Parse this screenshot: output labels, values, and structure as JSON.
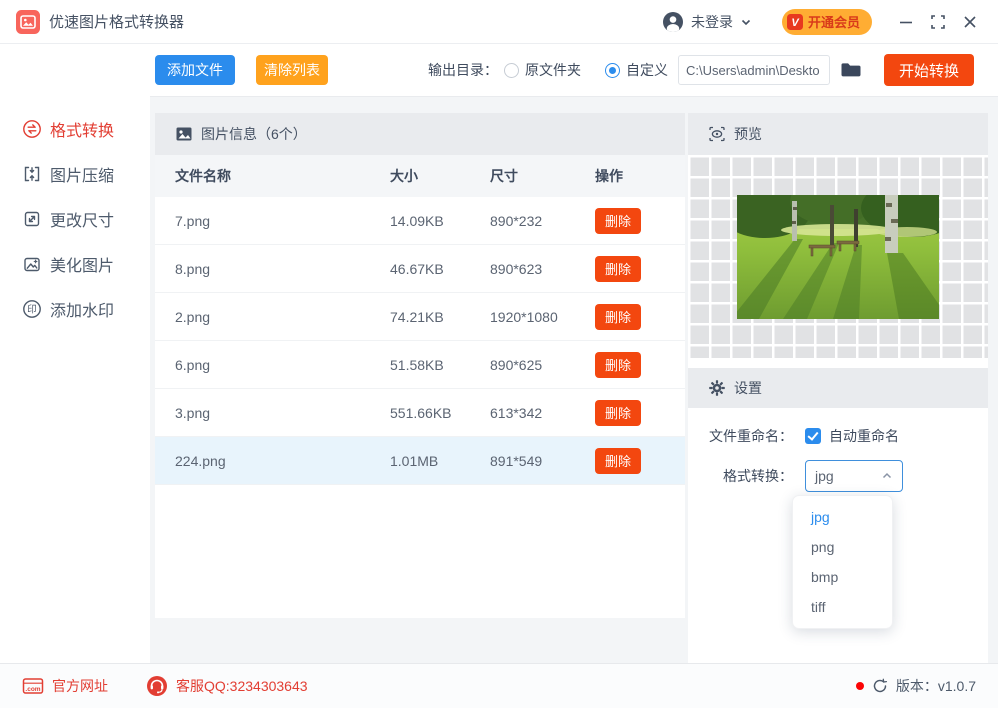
{
  "colors": {
    "brand": "#f8655c",
    "blue": "#2b8ced",
    "orange": "#ffa21d",
    "vermillion": "#f3470f",
    "vip": "#ffad33",
    "red": "#e23e33"
  },
  "window": {
    "title": "优速图片格式转换器",
    "login": "未登录",
    "vip": "开通会员"
  },
  "toolbar": {
    "add": "添加文件",
    "clear": "清除列表",
    "output_label": "输出目录：",
    "radio_source": "原文件夹",
    "radio_custom": "自定义",
    "path": "C:\\Users\\admin\\Deskto",
    "start": "开始转换"
  },
  "sidebar": {
    "items": [
      {
        "id": "format-convert",
        "label": "格式转换",
        "active": true
      },
      {
        "id": "compress",
        "label": "图片压缩",
        "active": false
      },
      {
        "id": "resize",
        "label": "更改尺寸",
        "active": false
      },
      {
        "id": "beautify",
        "label": "美化图片",
        "active": false
      },
      {
        "id": "watermark",
        "label": "添加水印",
        "active": false
      }
    ]
  },
  "table": {
    "panel_title": "图片信息（6个）",
    "headers": [
      "文件名称",
      "大小",
      "尺寸",
      "操作"
    ],
    "delete_label": "删除",
    "selected_index": 5,
    "rows": [
      {
        "name": "7.png",
        "size": "14.09KB",
        "dim": "890*232"
      },
      {
        "name": "8.png",
        "size": "46.67KB",
        "dim": "890*623"
      },
      {
        "name": "2.png",
        "size": "74.21KB",
        "dim": "1920*1080"
      },
      {
        "name": "6.png",
        "size": "51.58KB",
        "dim": "890*625"
      },
      {
        "name": "3.png",
        "size": "551.66KB",
        "dim": "613*342"
      },
      {
        "name": "224.png",
        "size": "1.01MB",
        "dim": "891*549"
      }
    ]
  },
  "preview": {
    "title": "预览"
  },
  "settings": {
    "title": "设置",
    "rename_label": "文件重命名：",
    "rename_checkbox": "自动重命名",
    "rename_checked": true,
    "format_label": "格式转换：",
    "format_value": "jpg",
    "options": [
      "jpg",
      "png",
      "bmp",
      "tiff"
    ]
  },
  "footer": {
    "site": "官方网址",
    "qq": "客服QQ:3234303643",
    "version": "版本：v1.0.7"
  }
}
